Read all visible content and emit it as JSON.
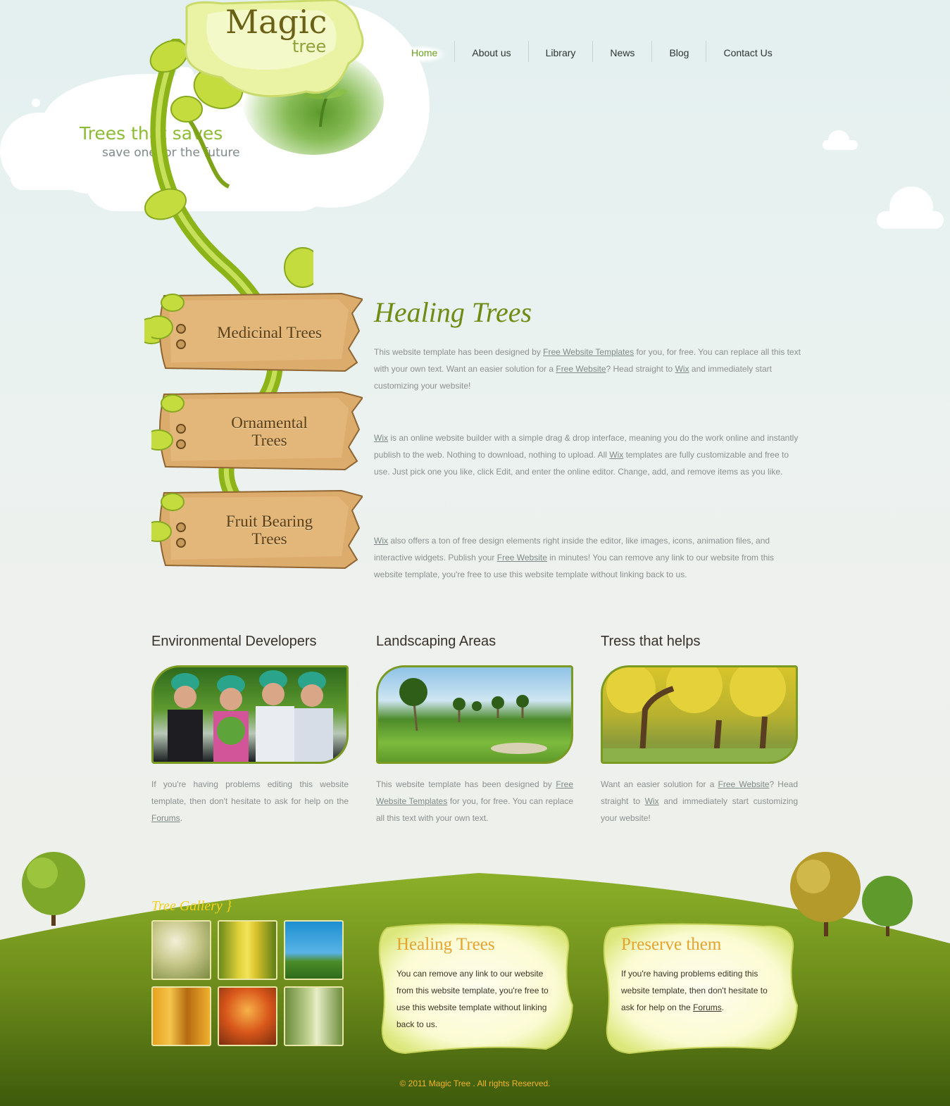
{
  "brand": {
    "name_line1": "Magic",
    "name_line2": "tree"
  },
  "nav": {
    "items": [
      {
        "label": "Home"
      },
      {
        "label": "About us"
      },
      {
        "label": "Library"
      },
      {
        "label": "News"
      },
      {
        "label": "Blog"
      },
      {
        "label": "Contact Us"
      }
    ],
    "active": "Home"
  },
  "hero": {
    "line1": "Trees that saves",
    "line2": "save one for the future"
  },
  "sidebar": {
    "boards": [
      {
        "line1": "Medicinal Trees",
        "line2": ""
      },
      {
        "line1": "Ornamental",
        "line2": "Trees"
      },
      {
        "line1": "Fruit Bearing",
        "line2": "Trees"
      }
    ]
  },
  "main": {
    "title": "Healing Trees",
    "p1": {
      "t1": "This website template has been designed by ",
      "l1": "Free Website Templates",
      "t2": " for you, for free. You can replace all this text with your own text. Want an easier solution for a ",
      "l2": "Free Website",
      "t3": "? Head straight to ",
      "l3": "Wix",
      "t4": " and immediately start customizing your website!"
    },
    "p2": {
      "l1": "Wix",
      "t1": " is an online website builder with a simple drag & drop interface, meaning you do the work online and instantly publish to the web. Nothing to download, nothing to upload. All ",
      "l2": "Wix",
      "t2": " templates are fully customizable and free to use. Just pick one you like, click Edit, and enter the online editor. Change, add, and remove items as you like."
    },
    "p3": {
      "l1": "Wix",
      "t1": " also offers a ton of free design elements right inside the editor, like images, icons, animation files, and interactive widgets. Publish your ",
      "l2": "Free Website",
      "t2": " in minutes! You can remove any link to our website from this website template, you're free to use this website template without linking back to us."
    }
  },
  "columns": [
    {
      "title": "Environmental Developers",
      "t1": "If you're having problems editing this website template, then don't hesitate to ask for help on the ",
      "l1": "Forums",
      "t2": "."
    },
    {
      "title": "Landscaping Areas",
      "t1": "This website template has been designed by ",
      "l1": "Free Website Templates",
      "t2": " for you, for free. You can replace all this text with your own text."
    },
    {
      "title": "Tress that helps",
      "t1": "Want an easier solution for a ",
      "l1": "Free Website",
      "t2": "? Head straight to ",
      "l2": "Wix",
      "t3": " and immediately start customizing your website!"
    }
  ],
  "footer": {
    "gallery_title": "Tree Gallery }",
    "note1": {
      "title": "Healing Trees",
      "text": "You can remove any link to our website from this website template, you're free to use this website template without linking back to us."
    },
    "note2": {
      "title": "Preserve them",
      "t1": "If you're having problems editing this website template, then don't hesitate to ask for help on the ",
      "l1": "Forums",
      "t2": "."
    },
    "copyright": "© 2011 Magic Tree . All rights Reserved."
  },
  "colors": {
    "accent_green": "#6e8c14",
    "footer_green": "#6b8a1a",
    "note_title": "#e5a430",
    "copyright": "#f2b429"
  }
}
